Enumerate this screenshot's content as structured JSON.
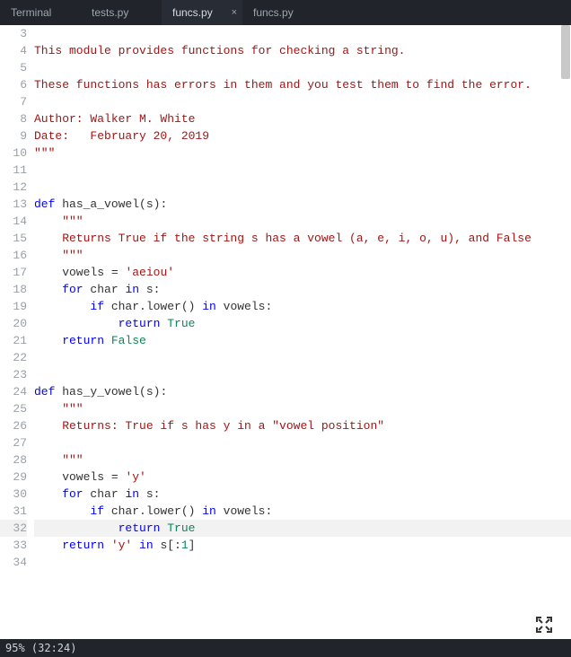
{
  "tabs": [
    {
      "label": "Terminal",
      "active": false,
      "close": false
    },
    {
      "label": "tests.py",
      "active": false,
      "close": false
    },
    {
      "label": "funcs.py",
      "active": true,
      "close": true
    },
    {
      "label": "funcs.py",
      "active": false,
      "close": false
    }
  ],
  "close_glyph": "×",
  "gutter": {
    "start": 3,
    "end": 34
  },
  "code": {
    "l4": "This module provides functions for checking a string.",
    "l6": "These functions has errors in them and you test them to find the error.",
    "l8": "Author: Walker M. White",
    "l9": "Date:   February 20, 2019",
    "l10": "\"\"\"",
    "l13_def": "def ",
    "l13_name": "has_a_vowel",
    "l13_paren_o": "(",
    "l13_arg": "s",
    "l13_paren_c": "):",
    "l14": "    \"\"\"",
    "l15": "    Returns True if the string s has a vowel (a, e, i, o, u), and False",
    "l16": "    \"\"\"",
    "l17_a": "    vowels ",
    "l17_eq": "= ",
    "l17_str": "'aeiou'",
    "l18_for": "    for ",
    "l18_var": "char ",
    "l18_in": "in ",
    "l18_s": "s:",
    "l19_if": "        if ",
    "l19_expr": "char.lower() ",
    "l19_in": "in ",
    "l19_v": "vowels:",
    "l20_ret": "            return ",
    "l20_true": "True",
    "l21_ret": "    return ",
    "l21_false": "False",
    "l24_def": "def ",
    "l24_name": "has_y_vowel",
    "l24_paren_o": "(",
    "l24_arg": "s",
    "l24_paren_c": "):",
    "l25": "    \"\"\"",
    "l26": "    Returns: True if s has y in a \"vowel position\"",
    "l28": "    \"\"\"",
    "l29_a": "    vowels ",
    "l29_eq": "= ",
    "l29_str": "'y'",
    "l30_for": "    for ",
    "l30_var": "char ",
    "l30_in": "in ",
    "l30_s": "s:",
    "l31_if": "        if ",
    "l31_expr": "char.lower() ",
    "l31_in": "in ",
    "l31_v": "vowels:",
    "l32_ret": "            return ",
    "l32_true": "True",
    "l33_ret": "    return ",
    "l33_expr_a": "'y'",
    "l33_in": " in ",
    "l33_expr_b": "s[:",
    "l33_num": "1",
    "l33_close": "]"
  },
  "status": "95%  (32:24)",
  "highlighted_line": 32
}
